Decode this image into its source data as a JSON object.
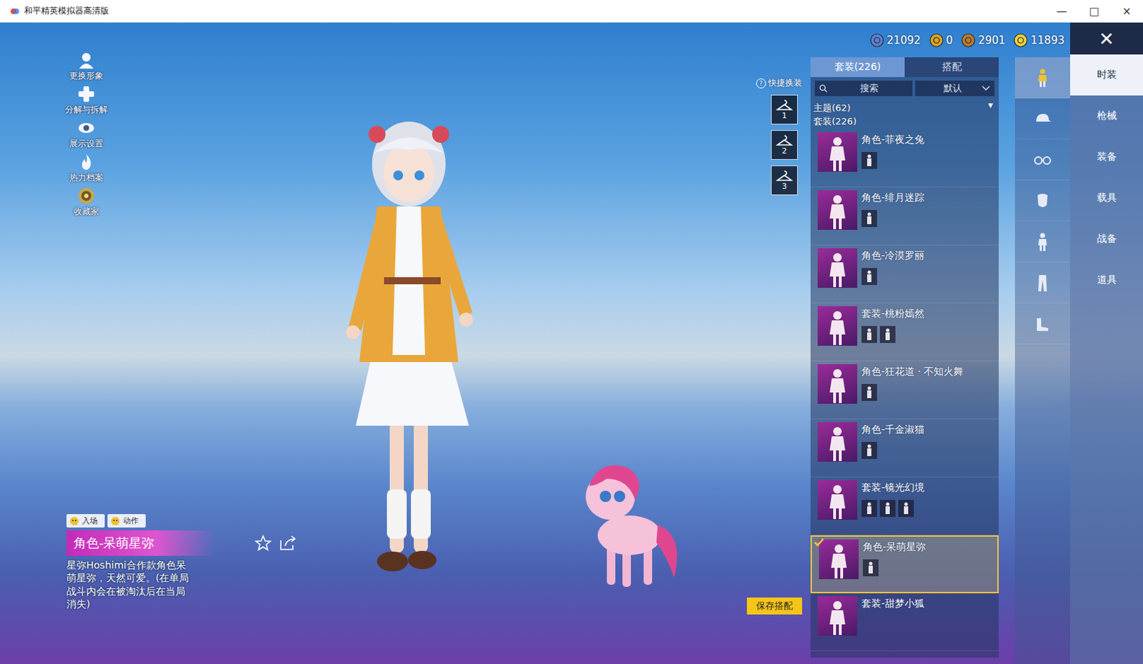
{
  "window": {
    "title": "和平精英模拟器高清版",
    "controls": [
      "—",
      "□",
      "×"
    ]
  },
  "side_menu": [
    {
      "label": "更换形象",
      "kind": "avatar"
    },
    {
      "label": "分解与拆解",
      "kind": "decompose"
    },
    {
      "label": "展示设置",
      "kind": "display"
    },
    {
      "label": "热力档案",
      "kind": "heat"
    },
    {
      "label": "收藏家",
      "kind": "collector"
    }
  ],
  "actions": [
    {
      "label": "入场"
    },
    {
      "label": "动作"
    }
  ],
  "selected_item": {
    "name": "角色-呆萌星弥",
    "description": "星弥Hoshimi合作款角色呆萌星弥，天然可爱。(在单局战斗内会在被淘汰后在当局消失)"
  },
  "currencies": [
    {
      "value": "21092",
      "color": "#5b7fd6"
    },
    {
      "value": "0",
      "color": "#d9a520"
    },
    {
      "value": "2901",
      "color": "#c27a2c"
    },
    {
      "value": "11893",
      "color": "#f2d33a"
    }
  ],
  "quick_change": {
    "label": "快捷换装",
    "help": "?",
    "slots": [
      "1",
      "2",
      "3"
    ]
  },
  "save_button": "保存搭配",
  "panel": {
    "tabs": [
      {
        "label": "套装(226)",
        "selected": true
      },
      {
        "label": "搭配",
        "selected": false
      }
    ],
    "search": {
      "placeholder": "搜索"
    },
    "sort": {
      "value": "默认"
    },
    "theme_filter": {
      "label": "主题(62)",
      "arrow": "▼"
    },
    "group_label": "套装(226)",
    "items": [
      {
        "name": "角色-菲夜之兔",
        "parts": 1,
        "selected": false
      },
      {
        "name": "角色-绯月迷踪",
        "parts": 1,
        "selected": false
      },
      {
        "name": "角色-冷漠罗丽",
        "parts": 1,
        "selected": false
      },
      {
        "name": "套装-桃粉嫣然",
        "parts": 2,
        "selected": false
      },
      {
        "name": "角色-狂花道 · 不知火舞",
        "parts": 1,
        "selected": false
      },
      {
        "name": "角色-千金淑猫",
        "parts": 1,
        "selected": false
      },
      {
        "name": "套装-镜光幻境",
        "parts": 3,
        "selected": false
      },
      {
        "name": "角色-呆萌星弥",
        "parts": 1,
        "selected": true
      },
      {
        "name": "套装-甜梦小狐",
        "parts": 0,
        "selected": false
      }
    ]
  },
  "category_icons": [
    {
      "kind": "outfit",
      "selected": true
    },
    {
      "kind": "hat",
      "selected": false
    },
    {
      "kind": "glasses",
      "selected": false
    },
    {
      "kind": "mask",
      "selected": false
    },
    {
      "kind": "body",
      "selected": false
    },
    {
      "kind": "pants",
      "selected": false
    },
    {
      "kind": "shoes",
      "selected": false
    }
  ],
  "close_button": "✕",
  "main_tabs": [
    {
      "label": "时装",
      "selected": true
    },
    {
      "label": "枪械",
      "selected": false
    },
    {
      "label": "装备",
      "selected": false
    },
    {
      "label": "载具",
      "selected": false
    },
    {
      "label": "战备",
      "selected": false
    },
    {
      "label": "道具",
      "selected": false
    }
  ]
}
